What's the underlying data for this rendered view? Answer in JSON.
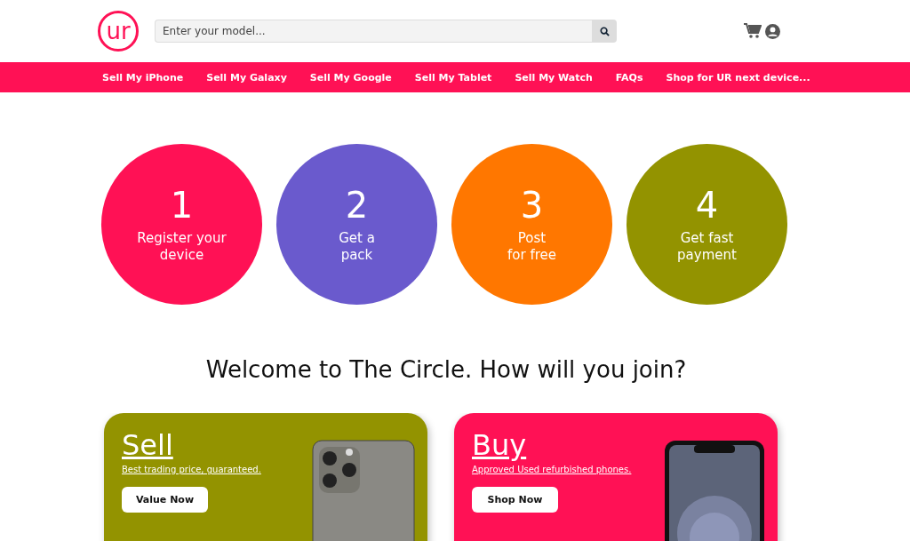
{
  "header": {
    "logo": "ur",
    "search": {
      "placeholder": "Enter your model..."
    }
  },
  "nav": {
    "items": [
      {
        "label": "Sell My iPhone"
      },
      {
        "label": "Sell My Galaxy"
      },
      {
        "label": "Sell My Google"
      },
      {
        "label": "Sell My Tablet"
      },
      {
        "label": "Sell My Watch"
      },
      {
        "label": "FAQs"
      }
    ],
    "shop_link": "Shop for UR next device..."
  },
  "steps": [
    {
      "number": "1",
      "lines": [
        "Register your",
        "device"
      ],
      "color": "#ff1155"
    },
    {
      "number": "2",
      "lines": [
        "Get a",
        "pack"
      ],
      "color": "#6a5acd"
    },
    {
      "number": "3",
      "lines": [
        "Post",
        "for free"
      ],
      "color": "#ff7700"
    },
    {
      "number": "4",
      "lines": [
        "Get fast",
        "payment"
      ],
      "color": "#939300"
    }
  ],
  "heading": "Welcome to The Circle. How will you join?",
  "cards": [
    {
      "kind": "back",
      "title": "Sell",
      "subtitle": "Best trading price, guaranteed.",
      "button": "Value Now",
      "color": "#939300"
    },
    {
      "kind": "front",
      "title": "Buy",
      "subtitle": "Approved Used refurbished phones.",
      "button": "Shop Now",
      "color": "#ff1155"
    }
  ]
}
